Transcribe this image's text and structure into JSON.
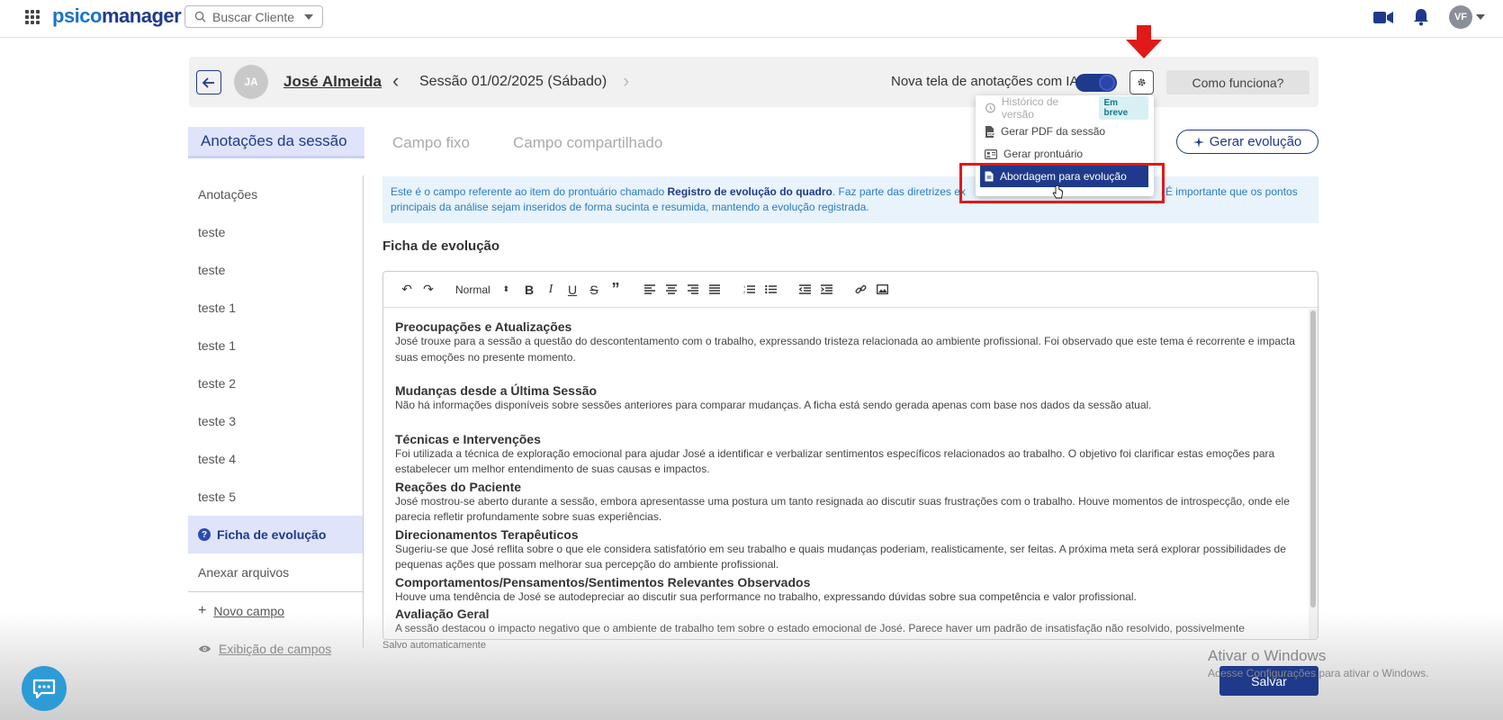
{
  "topbar": {
    "logo_a": "psico",
    "logo_b": "manager",
    "search_placeholder": "Buscar Cliente",
    "user_initials": "VF"
  },
  "header": {
    "patient_initials": "JA",
    "patient_name": "José Almeida",
    "session_title": "Sessão 01/02/2025 (Sábado)",
    "ai_toggle_label": "Nova tela de anotações com IA",
    "how_it_works": "Como funciona?"
  },
  "tabs": {
    "active": "Anotações da sessão",
    "fixed": "Campo fixo",
    "shared": "Campo compartilhado",
    "generate_evolution": "Gerar evolução"
  },
  "sidebar": {
    "items": [
      "Anotações",
      "teste",
      "teste",
      "teste 1",
      "teste 1",
      "teste 2",
      "teste 3",
      "teste 4",
      "teste 5"
    ],
    "active_item": "Ficha de evolução",
    "attach": "Anexar arquivos",
    "new_field": "Novo campo",
    "field_display": "Exibição de campos"
  },
  "info_banner": {
    "text_a": "Este é o campo referente ao item do prontuário chamado ",
    "text_bold": "Registro de evolução do quadro",
    "text_b": ". Faz parte das diretrizes ex",
    "text_c": "É importante que os pontos principais da análise sejam inseridos de forma sucinta e resumida, mantendo a evolução registrada."
  },
  "section_title": "Ficha de evolução",
  "editor": {
    "format_select": "Normal",
    "blocks": [
      {
        "title": "Preocupações e Atualizações",
        "text": "José trouxe para a sessão a questão do descontentamento com o trabalho, expressando tristeza relacionada ao ambiente profissional. Foi observado que este tema é recorrente e impacta suas emoções no presente momento."
      },
      {
        "title": "Mudanças desde a Última Sessão",
        "text": "Não há informações disponíveis sobre sessões anteriores para comparar mudanças. A ficha está sendo gerada apenas com base nos dados da sessão atual."
      },
      {
        "title": "Técnicas e Intervenções",
        "text": "Foi utilizada a técnica de exploração emocional para ajudar José a identificar e verbalizar sentimentos específicos relacionados ao trabalho. O objetivo foi clarificar estas emoções para estabelecer um melhor entendimento de suas causas e impactos."
      },
      {
        "title": "Reações do Paciente",
        "text": "José mostrou-se aberto durante a sessão, embora apresentasse uma postura um tanto resignada ao discutir suas frustrações com o trabalho. Houve momentos de introspecção, onde ele parecia refletir profundamente sobre suas experiências."
      },
      {
        "title": "Direcionamentos Terapêuticos",
        "text": "Sugeriu-se que José reflita sobre o que ele considera satisfatório em seu trabalho e quais mudanças poderiam, realisticamente, ser feitas. A próxima meta será explorar possibilidades de pequenas ações que possam melhorar sua percepção do ambiente profissional."
      },
      {
        "title": "Comportamentos/Pensamentos/Sentimentos Relevantes Observados",
        "text": "Houve uma tendência de José se autodepreciar ao discutir sua performance no trabalho, expressando dúvidas sobre sua competência e valor profissional."
      },
      {
        "title": "Avaliação Geral",
        "text": "A sessão destacou o impacto negativo que o ambiente de trabalho tem sobre o estado emocional de José. Parece haver um padrão de insatisfação não resolvido, possivelmente exacerbado por autocríticas e falta de reconhecimento pessoal. O foco será em trabalhar a autoestima e a identificação de fatores controláveis que melhorem sua experiência no"
      }
    ]
  },
  "saved_status": "Salvo automaticamente",
  "dropdown": {
    "version_history": "Histórico de versão",
    "soon_badge": "Em breve",
    "gen_pdf": "Gerar PDF da sessão",
    "gen_record": "Gerar prontuário",
    "approach": "Abordagem para evolução"
  },
  "footer": {
    "save": "Salvar",
    "win_title": "Ativar o Windows",
    "win_sub": "Acesse Configurações para ativar o Windows."
  },
  "colors": {
    "primary": "#1f3a8a",
    "accent": "#1a73c8",
    "highlight_red": "#e01919"
  }
}
